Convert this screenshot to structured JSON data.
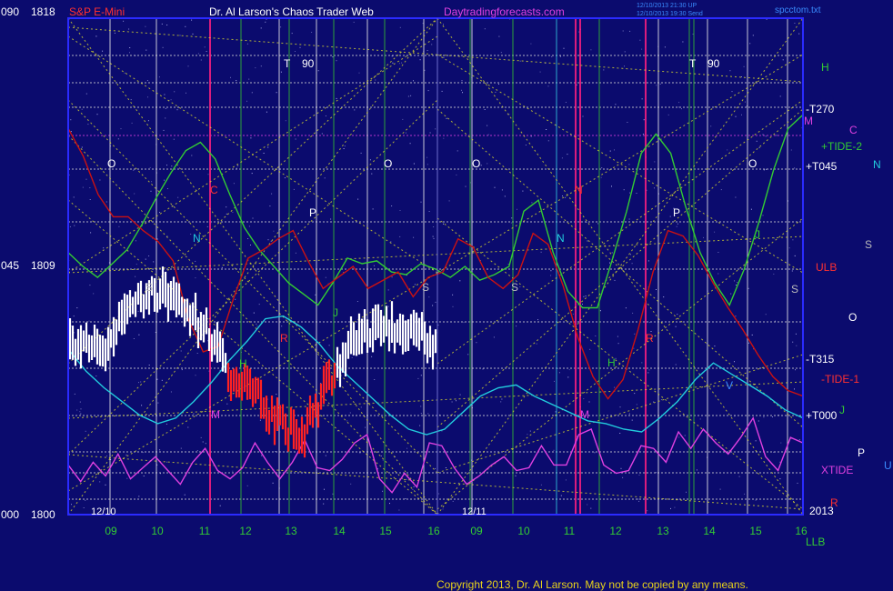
{
  "header": {
    "left_axis_top_angle": "090",
    "left_axis_top_price": "1818",
    "instrument": "S&P E-Mini",
    "product": "Dr. Al Larson's Chaos Trader Web",
    "site": "Daytradingforecasts.com",
    "stamp_line1": "12/10/2013 21:30 UP",
    "stamp_line2": "12/10/2013 19:30 Send",
    "file": "spcctom.txt"
  },
  "left_axis": {
    "mid_angle": "045",
    "mid_price": "1809",
    "bottom_angle": "000",
    "bottom_price": "1800"
  },
  "footer": {
    "copyright": "Copyright 2013, Dr. Al Larson. May not be copied by any means."
  },
  "chart_data": {
    "type": "line",
    "title": "S&P E-Mini",
    "xlabel": "",
    "ylabel": "",
    "ylim": [
      1800,
      1818
    ],
    "y_ticks": [
      "1800",
      "1809",
      "1818"
    ],
    "grid": true,
    "date_markers": [
      "12/10",
      "12/11"
    ],
    "x_tick_labels": [
      "09",
      "10",
      "11",
      "12",
      "13",
      "14",
      "15",
      "16",
      "09",
      "10",
      "11",
      "12",
      "13",
      "14",
      "15",
      "16"
    ],
    "year_label": "2013",
    "right_labels": [
      "H",
      "-T270",
      "M",
      "C",
      "+TIDE-2",
      "N",
      "+T045",
      "S",
      "ULB",
      "O",
      "-T315",
      "-TIDE-1",
      "+T000",
      "J",
      "P",
      "XTIDE",
      "U",
      "R",
      "LLB"
    ],
    "plot_labels": [
      "T",
      "90",
      "T",
      "90",
      "O",
      "O",
      "O",
      "O",
      "C",
      "N",
      "N",
      "N",
      "P",
      "P",
      "S",
      "S",
      "S",
      "S",
      "R",
      "R",
      "H",
      "H",
      "J",
      "J",
      "M",
      "M",
      "V"
    ],
    "colors": {
      "background": "#0b0b6e",
      "frame": "#2b2bff",
      "price": "#ff2222",
      "price_up": "#ffffff",
      "tide_green": "#33cc33",
      "tide_red": "#cc1111",
      "xtide": "#e040e0",
      "ma_cyan": "#22ccdd",
      "ma_yellow": "#e8d21a",
      "vline_white": "#e8e8e8",
      "vline_green": "#33bb33",
      "vline_cyan": "#33c6e0",
      "vline_red": "#ff2080",
      "gann_yellow": "#e6e62a"
    },
    "series": [
      {
        "values": [
          1806,
          1805.2,
          1804.6,
          1804.1,
          1803.6,
          1803.3,
          1803.5,
          1804.1,
          1804.8,
          1805.6,
          1806.3,
          1807.1,
          1807.2,
          1806.8,
          1806.2,
          1805.4,
          1804.8,
          1804.2,
          1803.6,
          1803.1,
          1802.9,
          1803.1,
          1803.7,
          1804.3,
          1804.6,
          1804.7,
          1804.3,
          1804,
          1803.7,
          1803.4,
          1803.3,
          1803.1,
          1803,
          1803.5,
          1804.1,
          1804.9,
          1805.5,
          1805.1,
          1804.7,
          1804.3,
          1803.8,
          1803.5
        ]
      },
      {
        "values": [
          1809.5,
          1809,
          1808.6,
          1809.1,
          1809.6,
          1810.5,
          1811.5,
          1812.4,
          1813.2,
          1813.5,
          1812.9,
          1811.6,
          1810.4,
          1809.6,
          1809,
          1808.4,
          1808,
          1807.6,
          1808.4,
          1809.3,
          1809.1,
          1809.2,
          1808.8,
          1808.7,
          1809.1,
          1808.9,
          1808.6,
          1809,
          1808.5,
          1808.7,
          1809,
          1811,
          1811.4,
          1809.5,
          1808.1,
          1807.5,
          1807.5,
          1809.2,
          1811,
          1813.1,
          1813.8,
          1813.1,
          1811.2,
          1809.5,
          1808.4,
          1807.6,
          1808.9,
          1810.6,
          1812.5,
          1814,
          1814.5
        ]
      },
      {
        "values": [
          1814,
          1813,
          1811.6,
          1810.8,
          1810.8,
          1810.3,
          1809.9,
          1809.2,
          1807.1,
          1805.9,
          1806.1,
          1807.8,
          1809.3,
          1809.6,
          1810,
          1810.3,
          1809.2,
          1808.2,
          1808.6,
          1809,
          1808.2,
          1808.5,
          1808.8,
          1807.9,
          1808.6,
          1808.8,
          1810,
          1809.7,
          1808.6,
          1808.2,
          1808.7,
          1810.2,
          1809.8,
          1808.3,
          1806.4,
          1805,
          1804.2,
          1804.9,
          1806.7,
          1808.8,
          1810.3,
          1810.1,
          1809.4,
          1808.4,
          1807.5,
          1806.7,
          1805.8,
          1805,
          1804.5,
          1804.3
        ]
      },
      {
        "values": [
          1801.8,
          1801.2,
          1801.9,
          1801.4,
          1802.2,
          1801.3,
          1801.7,
          1802.1,
          1801.6,
          1801.1,
          1801.9,
          1802.4,
          1801.6,
          1801.3,
          1801.7,
          1802.6,
          1801.9,
          1801.3,
          1801.9,
          1802.7,
          1801.7,
          1801.6,
          1802,
          1802.6,
          1802.9,
          1801.3,
          1800.8,
          1801.5,
          1801,
          1802.6,
          1802.5,
          1801.7,
          1801.1,
          1801.4,
          1801.8,
          1802.1,
          1801.6,
          1801.7,
          1802.5,
          1801.8,
          1801.8,
          1802.9,
          1803.1,
          1801.8,
          1801.5,
          1801.6,
          1802.5,
          1802.4,
          1801.9,
          1803,
          1802.4,
          1803.1,
          1802.6,
          1802.2,
          1802.8,
          1803.5,
          1802.1,
          1801.6,
          1802.8,
          1802.6
        ]
      }
    ]
  }
}
